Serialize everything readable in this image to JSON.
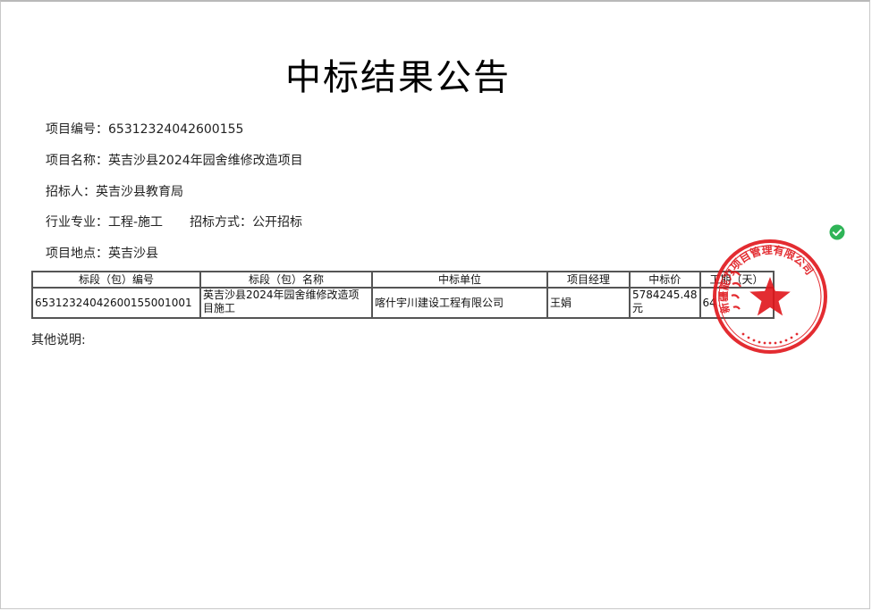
{
  "title": "中标结果公告",
  "fields": {
    "project_no": {
      "label": "项目编号：",
      "value": "65312324042600155"
    },
    "project_name": {
      "label": "项目名称：",
      "value": "英吉沙县2024年园舍维修改造项目"
    },
    "tenderer": {
      "label": "招标人：",
      "value": "英吉沙县教育局"
    },
    "industry": {
      "label": "行业专业：",
      "value": "工程-施工"
    },
    "method": {
      "label": "招标方式：",
      "value": "公开招标"
    },
    "location": {
      "label": "项目地点：",
      "value": "英吉沙县"
    }
  },
  "table": {
    "headers": [
      "标段（包）编号",
      "标段（包）名称",
      "中标单位",
      "项目经理",
      "中标价",
      "工期（天）"
    ],
    "rows": [
      [
        "65312324042600155001001",
        "英吉沙县2024年园舍维修改造项目施工",
        "喀什宇川建设工程有限公司",
        "王娟",
        "5784245.48元",
        "64"
      ]
    ]
  },
  "other_label": "其他说明:",
  "seal": {
    "color": "#e0161b",
    "text": "新疆能力项目管理有限公司"
  },
  "verified_icon": "check-circle-icon",
  "colors": {
    "check": "#2fb457"
  }
}
